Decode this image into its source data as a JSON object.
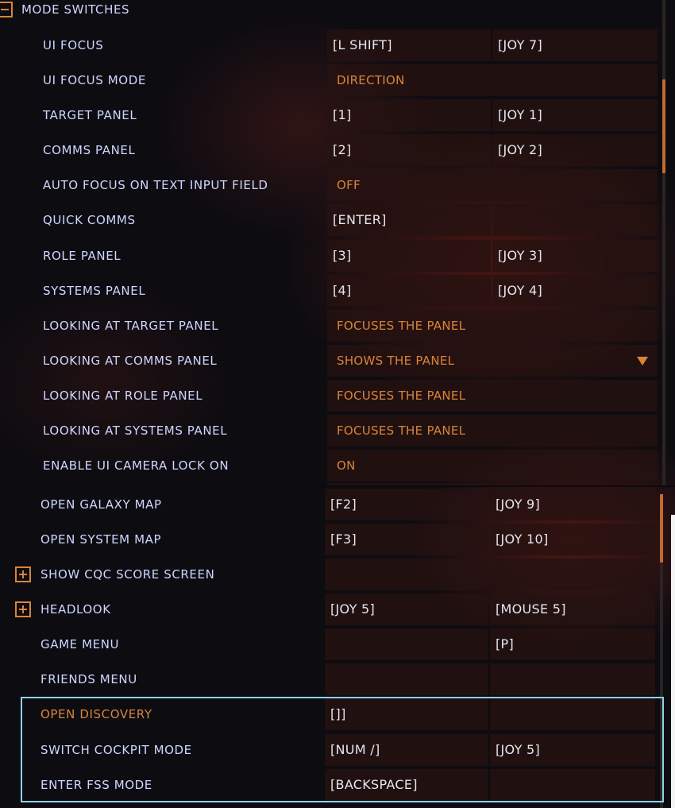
{
  "section": {
    "title": "MODE SWITCHES"
  },
  "panel1_rows": [
    {
      "label": "UI FOCUS",
      "primary": "[L SHIFT]",
      "secondary": "[JOY 7]"
    },
    {
      "label": "UI FOCUS MODE",
      "option": "DIRECTION"
    },
    {
      "label": "TARGET PANEL",
      "primary": "[1]",
      "secondary": "[JOY 1]"
    },
    {
      "label": "COMMS PANEL",
      "primary": "[2]",
      "secondary": "[JOY 2]"
    },
    {
      "label": "AUTO FOCUS ON TEXT INPUT FIELD",
      "option": "OFF"
    },
    {
      "label": "QUICK COMMS",
      "primary": "[ENTER]",
      "secondary": ""
    },
    {
      "label": "ROLE PANEL",
      "primary": "[3]",
      "secondary": "[JOY 3]"
    },
    {
      "label": "SYSTEMS PANEL",
      "primary": "[4]",
      "secondary": "[JOY 4]"
    },
    {
      "label": "LOOKING AT TARGET PANEL",
      "option": "FOCUSES THE PANEL"
    },
    {
      "label": "LOOKING AT COMMS PANEL",
      "option": "SHOWS THE PANEL"
    },
    {
      "label": "LOOKING AT ROLE PANEL",
      "option": "FOCUSES THE PANEL"
    },
    {
      "label": "LOOKING AT SYSTEMS PANEL",
      "option": "FOCUSES THE PANEL"
    },
    {
      "label": "ENABLE UI CAMERA LOCK ON",
      "option": "ON"
    }
  ],
  "panel2_rows": [
    {
      "label": "OPEN GALAXY MAP",
      "primary": "[F2]",
      "secondary": "[JOY 9]"
    },
    {
      "label": "OPEN SYSTEM MAP",
      "primary": "[F3]",
      "secondary": "[JOY 10]"
    },
    {
      "label": "SHOW CQC SCORE SCREEN",
      "primary": "",
      "secondary": ""
    },
    {
      "label": "HEADLOOK",
      "primary": "[JOY 5]",
      "secondary": "[MOUSE 5]"
    },
    {
      "label": "GAME MENU",
      "primary": "",
      "secondary": "[P]"
    },
    {
      "label": "FRIENDS MENU",
      "primary": "",
      "secondary": ""
    },
    {
      "label": "OPEN DISCOVERY",
      "primary": "[]]",
      "secondary": ""
    },
    {
      "label": "SWITCH COCKPIT MODE",
      "primary": "[NUM /]",
      "secondary": "[JOY 5]"
    },
    {
      "label": "ENTER FSS MODE",
      "primary": "[BACKSPACE]",
      "secondary": ""
    }
  ],
  "colors": {
    "label": "#cfd6ff",
    "accent": "#d9843a",
    "highlight": "#8fd0e8",
    "cell_bg": "#26121180"
  }
}
